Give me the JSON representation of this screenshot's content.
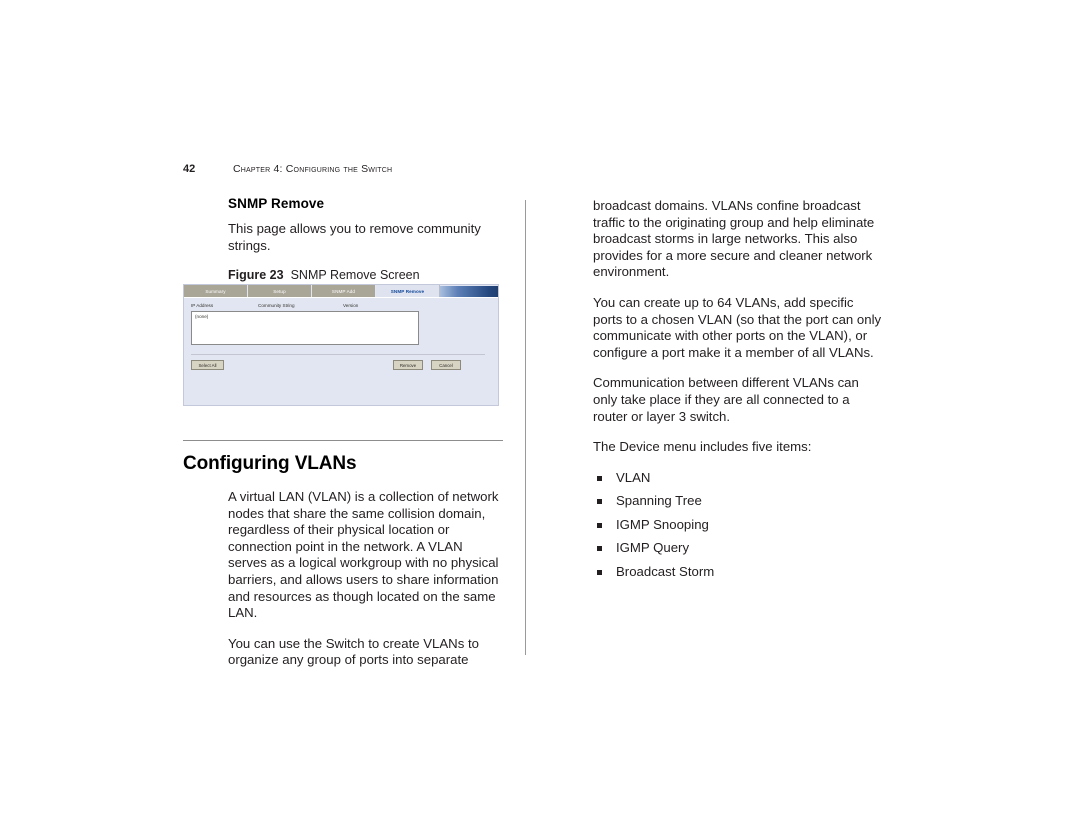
{
  "header": {
    "page_number": "42",
    "chapter_title": "Chapter 4: Configuring the Switch"
  },
  "left_column": {
    "section_heading": "SNMP Remove",
    "section_para": "This page allows you to remove community strings.",
    "figure": {
      "label": "Figure 23",
      "title": "SNMP Remove Screen",
      "tabs": [
        {
          "label": "Summary",
          "active": false
        },
        {
          "label": "Setup",
          "active": false
        },
        {
          "label": "SNMP Add",
          "active": false
        },
        {
          "label": "SNMP Remove",
          "active": true
        }
      ],
      "table": {
        "columns": [
          "IP Address",
          "Community String",
          "Version"
        ],
        "rows": [
          "(none)"
        ]
      },
      "buttons": {
        "select_all": "Select All",
        "remove": "Remove",
        "cancel": "Cancel"
      }
    },
    "chapter_heading": "Configuring VLANs",
    "paragraphs": [
      "A virtual LAN (VLAN) is a collection of network nodes that share the same collision domain, regardless of their physical location or connection point in the network. A VLAN serves as a logical workgroup with no physical barriers, and allows users to share information and resources as though located on the same LAN.",
      "You can use the Switch to create VLANs to organize any group of ports into separate"
    ]
  },
  "right_column": {
    "paragraphs": [
      "broadcast domains. VLANs confine broadcast traffic to the originating group and help eliminate broadcast storms in large networks. This also provides for a more secure and cleaner network environment.",
      "You can create up to 64 VLANs, add specific ports to a chosen VLAN (so that the port can only communicate with other ports on the VLAN), or configure a port make it a member of all VLANs.",
      "Communication between different VLANs can only take place if they are all connected to a router or layer 3 switch.",
      "The Device menu includes five items:"
    ],
    "menu_items": [
      "VLAN",
      "Spanning Tree",
      "IGMP Snooping",
      "IGMP Query",
      "Broadcast Storm"
    ]
  },
  "colors": {
    "figure_background": "#e2e6f2",
    "tab_inactive": "#a9a698",
    "tab_active_text": "#13499c",
    "button_face": "#d8d4c4",
    "rule": "#8d8d8d"
  }
}
